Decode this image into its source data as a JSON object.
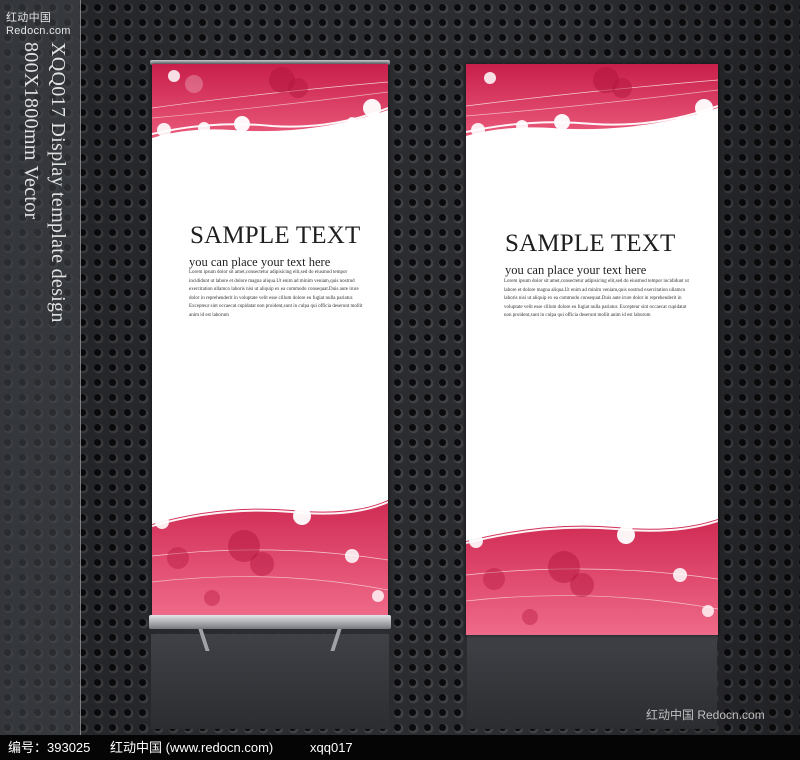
{
  "watermark_top": "红动中国 Redocn.com",
  "vertical_text": {
    "line1": "XQQ017 Display template design",
    "line2": "800X1800mm Vector"
  },
  "banners": [
    {
      "title": "SAMPLE TEXT",
      "subtitle": "you can place your text here",
      "body": "Lorem ipsum dolor sit amet,consectetur adipisicing elit,sed do eiusmod tempor incididunt ut labore et dolore magna aliqua.Ut enim ad minim veniam,quis nostrud exercitation ullamco laboris nisi ut aliquip ex ea commodo consequat.Duis aute irure dolor in reprehenderit in voluptate velit esse cillum dolore eu fugiat nulla pariatur. Excepteur sint occaecat cupidatat non proident,sunt in culpa qui officia deserunt mollit anim id est laborum"
    },
    {
      "title": "SAMPLE TEXT",
      "subtitle": "you can place your text here",
      "body": "Lorem ipsum dolor sit amet,consectetur adipisicing elit,sed do eiusmod tempor incididunt ut labore et dolore magna aliqua.Ut enim ad minim veniam,quis nostrud exercitation ullamco laboris nisi ut aliquip ex ea commodo consequat.Duis aute irure dolor in reprehenderit in voluptate velit esse cillum dolore eu fugiat nulla pariatur. Excepteur sint occaecat cupidatat non proident,sunt in culpa qui officia deserunt mollit anim id est laborum"
    }
  ],
  "watermark_bottom_right": "红动中国 Redocn.com",
  "footer": {
    "id_label": "编号：393025",
    "site": "红动中国 (www.redocn.com)",
    "code": "xqq017"
  },
  "colors": {
    "accent_pink": "#d42c57",
    "accent_dark_pink": "#b0183f",
    "background": "#2b2c30"
  }
}
